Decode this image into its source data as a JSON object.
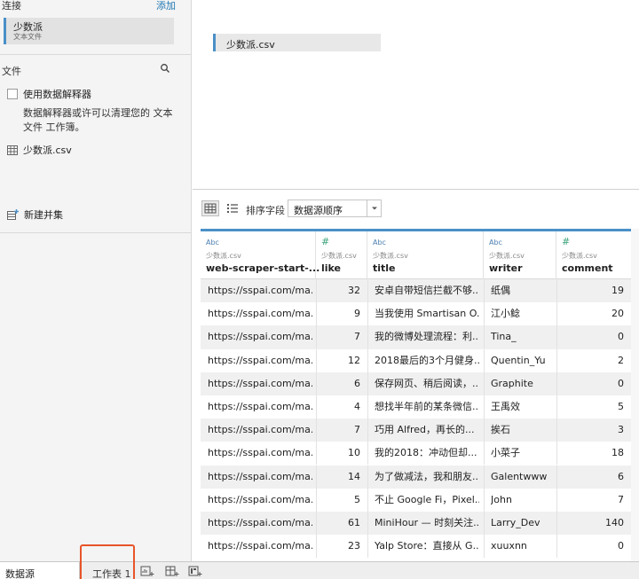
{
  "sidebar": {
    "connections_title": "连接",
    "add_label": "添加",
    "connection": {
      "name": "少数派",
      "type": "文本文件"
    },
    "files_title": "文件",
    "interpreter_label": "使用数据解释器",
    "interpreter_desc": "数据解释器或许可以清理您的 文本 文件 工作簿。",
    "file_name": "少数派.csv",
    "new_union_label": "新建并集"
  },
  "canvas": {
    "table_name": "少数派.csv"
  },
  "toolbar": {
    "sort_label": "排序字段",
    "sort_value": "数据源顺序"
  },
  "columns": [
    {
      "type": "Abc",
      "source": "少数派.csv",
      "name": "web-scraper-start-..."
    },
    {
      "type": "#",
      "source": "少数派.csv",
      "name": "like"
    },
    {
      "type": "Abc",
      "source": "少数派.csv",
      "name": "title"
    },
    {
      "type": "Abc",
      "source": "少数派.csv",
      "name": "writer"
    },
    {
      "type": "#",
      "source": "少数派.csv",
      "name": "comment"
    }
  ],
  "rows": [
    {
      "url": "https://sspai.com/ma...",
      "like": "32",
      "title": "安卓自带短信拦截不够...",
      "writer": "纸偶",
      "comment": "19"
    },
    {
      "url": "https://sspai.com/ma...",
      "like": "9",
      "title": "当我使用 Smartisan O...",
      "writer": "江小鲶",
      "comment": "20"
    },
    {
      "url": "https://sspai.com/ma...",
      "like": "7",
      "title": "我的微博处理流程：利...",
      "writer": "Tina_",
      "comment": "0"
    },
    {
      "url": "https://sspai.com/ma...",
      "like": "12",
      "title": "2018最后的3个月健身...",
      "writer": "Quentin_Yu",
      "comment": "2"
    },
    {
      "url": "https://sspai.com/ma...",
      "like": "6",
      "title": "保存网页、稍后阅读，...",
      "writer": "Graphite",
      "comment": "0"
    },
    {
      "url": "https://sspai.com/ma...",
      "like": "4",
      "title": "想找半年前的某条微信...",
      "writer": "王禹效",
      "comment": "5"
    },
    {
      "url": "https://sspai.com/ma...",
      "like": "7",
      "title": "巧用 Alfred，再长的...",
      "writer": "挨石",
      "comment": "3"
    },
    {
      "url": "https://sspai.com/ma...",
      "like": "10",
      "title": "我的2018：冲动但却...",
      "writer": "小菜子",
      "comment": "18"
    },
    {
      "url": "https://sspai.com/ma...",
      "like": "14",
      "title": "为了做减法，我和朋友...",
      "writer": "Galentwww",
      "comment": "6"
    },
    {
      "url": "https://sspai.com/ma...",
      "like": "5",
      "title": "不止 Google Fi，Pixel...",
      "writer": "John",
      "comment": "7"
    },
    {
      "url": "https://sspai.com/ma...",
      "like": "61",
      "title": "MiniHour — 时刻关注...",
      "writer": "Larry_Dev",
      "comment": "140"
    },
    {
      "url": "https://sspai.com/ma...",
      "like": "23",
      "title": "Yalp Store：直接从 G...",
      "writer": "xuuxnn",
      "comment": "0"
    }
  ],
  "bottom_tabs": {
    "datasource": "数据源",
    "worksheet": "工作表 1"
  },
  "colors": {
    "accent": "#4a90c8",
    "highlight": "#e8542a",
    "measure": "#3aa37a"
  }
}
